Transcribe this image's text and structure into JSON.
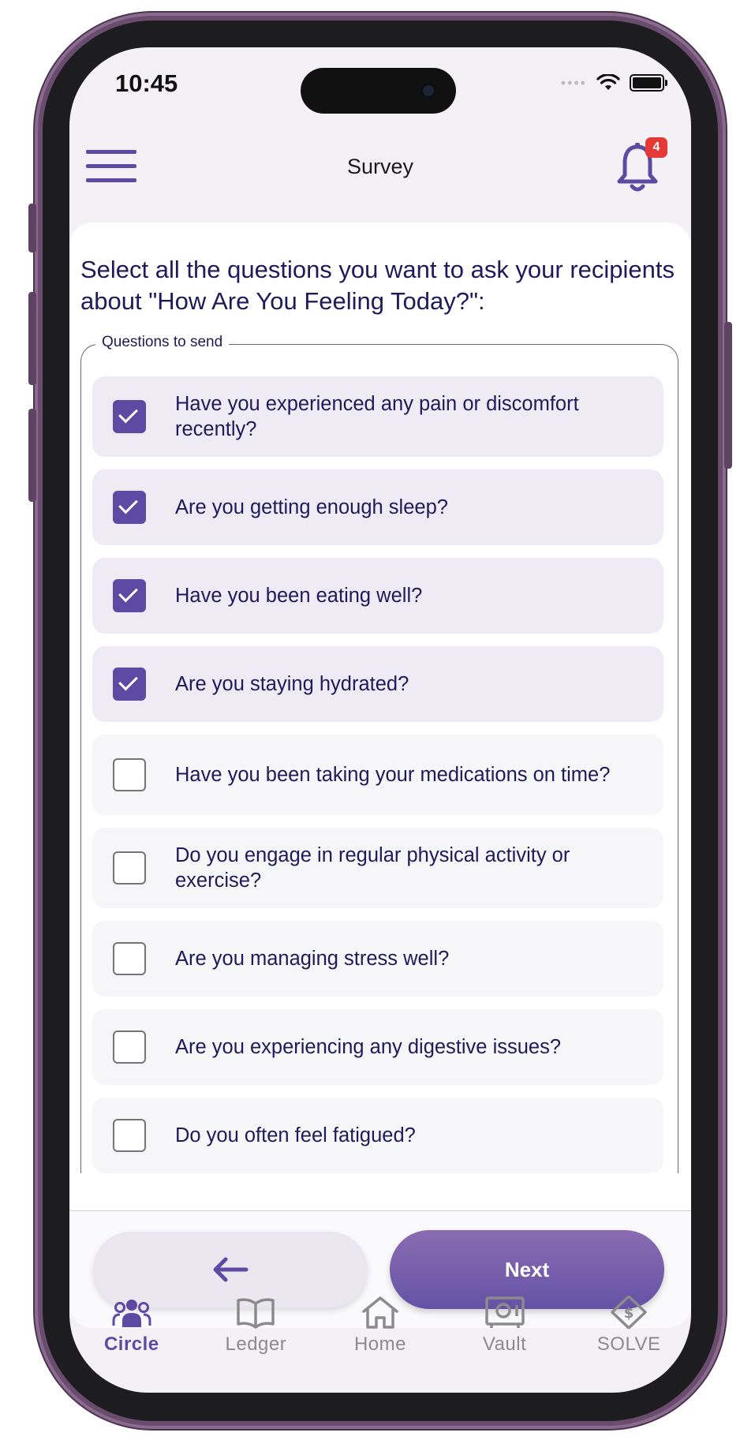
{
  "status_bar": {
    "time": "10:45"
  },
  "header": {
    "title": "Survey",
    "notification_count": "4"
  },
  "prompt": "Select all the questions you want to ask your recipients about \"How Are You Feeling Today?\":",
  "fieldset_label": "Questions to send",
  "questions": [
    {
      "text": "Have you experienced any pain or discomfort recently?",
      "checked": true
    },
    {
      "text": "Are you getting enough sleep?",
      "checked": true
    },
    {
      "text": "Have you been eating well?",
      "checked": true
    },
    {
      "text": "Are you staying hydrated?",
      "checked": true
    },
    {
      "text": "Have you been taking your medications on time?",
      "checked": false
    },
    {
      "text": "Do you engage in regular physical activity or exercise?",
      "checked": false
    },
    {
      "text": "Are you managing stress well?",
      "checked": false
    },
    {
      "text": "Are you experiencing any digestive issues?",
      "checked": false
    },
    {
      "text": "Do you often feel fatigued?",
      "checked": false
    }
  ],
  "actions": {
    "back_icon": "arrow-left-icon",
    "next_label": "Next"
  },
  "nav": {
    "items": [
      {
        "label": "Circle",
        "icon": "people-group-icon",
        "active": true
      },
      {
        "label": "Ledger",
        "icon": "open-book-icon",
        "active": false
      },
      {
        "label": "Home",
        "icon": "house-icon",
        "active": false
      },
      {
        "label": "Vault",
        "icon": "safe-icon",
        "active": false
      },
      {
        "label": "SOLVE",
        "icon": "dollar-diamond-icon",
        "active": false
      }
    ]
  },
  "colors": {
    "accent": "#5e4aa3",
    "text": "#1f1a5a",
    "badge": "#e53935",
    "frame": "#6a4c6e"
  }
}
